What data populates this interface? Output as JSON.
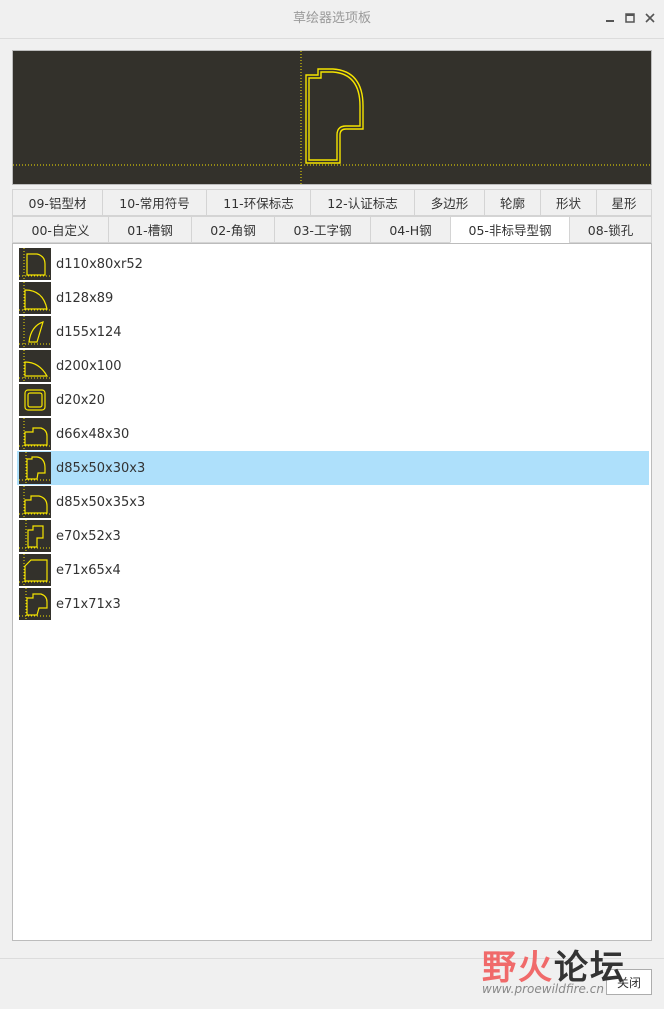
{
  "window": {
    "title": "草绘器选项板",
    "minimize_icon": "minimize-icon",
    "maximize_icon": "maximize-icon",
    "close_icon": "close-icon"
  },
  "tabs": {
    "row1": [
      {
        "label": "09-铝型材"
      },
      {
        "label": "10-常用符号"
      },
      {
        "label": "11-环保标志"
      },
      {
        "label": "12-认证标志"
      },
      {
        "label": "多边形"
      },
      {
        "label": "轮廓"
      },
      {
        "label": "形状"
      },
      {
        "label": "星形"
      }
    ],
    "row2": [
      {
        "label": "00-自定义"
      },
      {
        "label": "01-槽钢"
      },
      {
        "label": "02-角钢"
      },
      {
        "label": "03-工字钢"
      },
      {
        "label": "04-H钢"
      },
      {
        "label": "05-非标导型钢",
        "active": true
      },
      {
        "label": "08-锁孔"
      }
    ]
  },
  "list": {
    "items": [
      {
        "label": "d110x80xr52"
      },
      {
        "label": "d128x89"
      },
      {
        "label": "d155x124"
      },
      {
        "label": "d200x100"
      },
      {
        "label": "d20x20"
      },
      {
        "label": "d66x48x30"
      },
      {
        "label": "d85x50x30x3",
        "selected": true
      },
      {
        "label": "d85x50x35x3"
      },
      {
        "label": "e70x52x3"
      },
      {
        "label": "e71x65x4"
      },
      {
        "label": "e71x71x3"
      }
    ]
  },
  "footer": {
    "close_label": "关闭"
  },
  "watermark": {
    "main_a": "野火",
    "main_b": "论坛",
    "sub": "www.proewildfire.cn"
  },
  "colors": {
    "preview_bg": "#33312b",
    "shape_stroke": "#f5e400",
    "selection": "#aee0fb"
  }
}
